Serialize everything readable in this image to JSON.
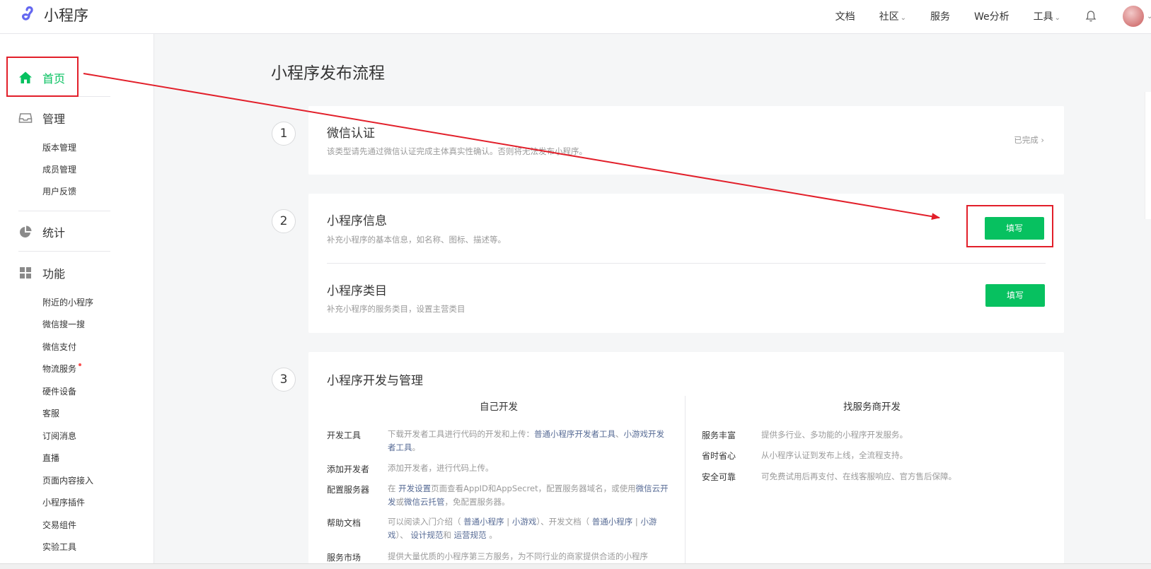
{
  "header": {
    "logo_text": "小程序",
    "nav": [
      {
        "label": "文档",
        "dropdown": false
      },
      {
        "label": "社区",
        "dropdown": true
      },
      {
        "label": "服务",
        "dropdown": false
      },
      {
        "label": "We分析",
        "dropdown": false
      },
      {
        "label": "工具",
        "dropdown": true
      }
    ]
  },
  "sidebar": {
    "home": "首页",
    "manage": "管理",
    "manage_items": [
      "版本管理",
      "成员管理",
      "用户反馈"
    ],
    "stats": "统计",
    "features": "功能",
    "feature_items": [
      "附近的小程序",
      "微信搜一搜",
      "微信支付",
      "物流服务",
      "硬件设备",
      "客服",
      "订阅消息",
      "直播",
      "页面内容接入",
      "小程序插件",
      "交易组件",
      "实验工具"
    ]
  },
  "main": {
    "title": "小程序发布流程",
    "step1": {
      "num": "1",
      "title": "微信认证",
      "desc": "该类型请先通过微信认证完成主体真实性确认。否则将无法发布小程序。",
      "status": "已完成"
    },
    "step2": {
      "num": "2",
      "info_title": "小程序信息",
      "info_desc": "补充小程序的基本信息，如名称、图标、描述等。",
      "info_button": "填写",
      "category_title": "小程序类目",
      "category_desc": "补充小程序的服务类目，设置主营类目",
      "category_button": "填写"
    },
    "step3": {
      "num": "3",
      "title": "小程序开发与管理",
      "self_dev": {
        "heading": "自己开发",
        "tools_label": "开发工具",
        "tools_text": "下载开发者工具进行代码的开发和上传：",
        "tools_link1": "普通小程序开发者工具",
        "tools_sep": "、",
        "tools_link2": "小游戏开发者工具",
        "tools_end": "。",
        "add_dev_label": "添加开发者",
        "add_dev_text": "添加开发者，进行代码上传。",
        "server_label": "配置服务器",
        "server_t1": "在 ",
        "server_link1": "开发设置",
        "server_t2": "页面查看AppID和AppSecret，配置服务器域名，或使用",
        "server_link2": "微信云开发",
        "server_t3": "或",
        "server_link3": "微信云托管",
        "server_t4": "，免配置服务器。",
        "help_label": "帮助文档",
        "help_t1": "可以阅读入门介绍（ ",
        "help_link1": "普通小程序",
        "help_t2": " | ",
        "help_link2": "小游戏",
        "help_t3": "）、开发文档（ ",
        "help_link3": "普通小程序",
        "help_t4": " | ",
        "help_link4": "小游戏",
        "help_t5": "）、 ",
        "help_link5": "设计规范",
        "help_t6": "和 ",
        "help_link6": "运营规范",
        "help_t7": " 。",
        "market_label": "服务市场",
        "market_text": "提供大量优质的小程序第三方服务，为不同行业的商家提供合适的小程序"
      },
      "provider": {
        "heading": "找服务商开发",
        "rows": [
          {
            "label": "服务丰富",
            "text": "提供多行业、多功能的小程序开发服务。"
          },
          {
            "label": "省时省心",
            "text": "从小程序认证到发布上线，全流程支持。"
          },
          {
            "label": "安全可靠",
            "text": "可免费试用后再支付、在线客服响应、官方售后保障。"
          }
        ]
      }
    }
  },
  "colors": {
    "accent": "#07c160",
    "annotation_red": "#e21f2a",
    "link": "#576b95"
  }
}
